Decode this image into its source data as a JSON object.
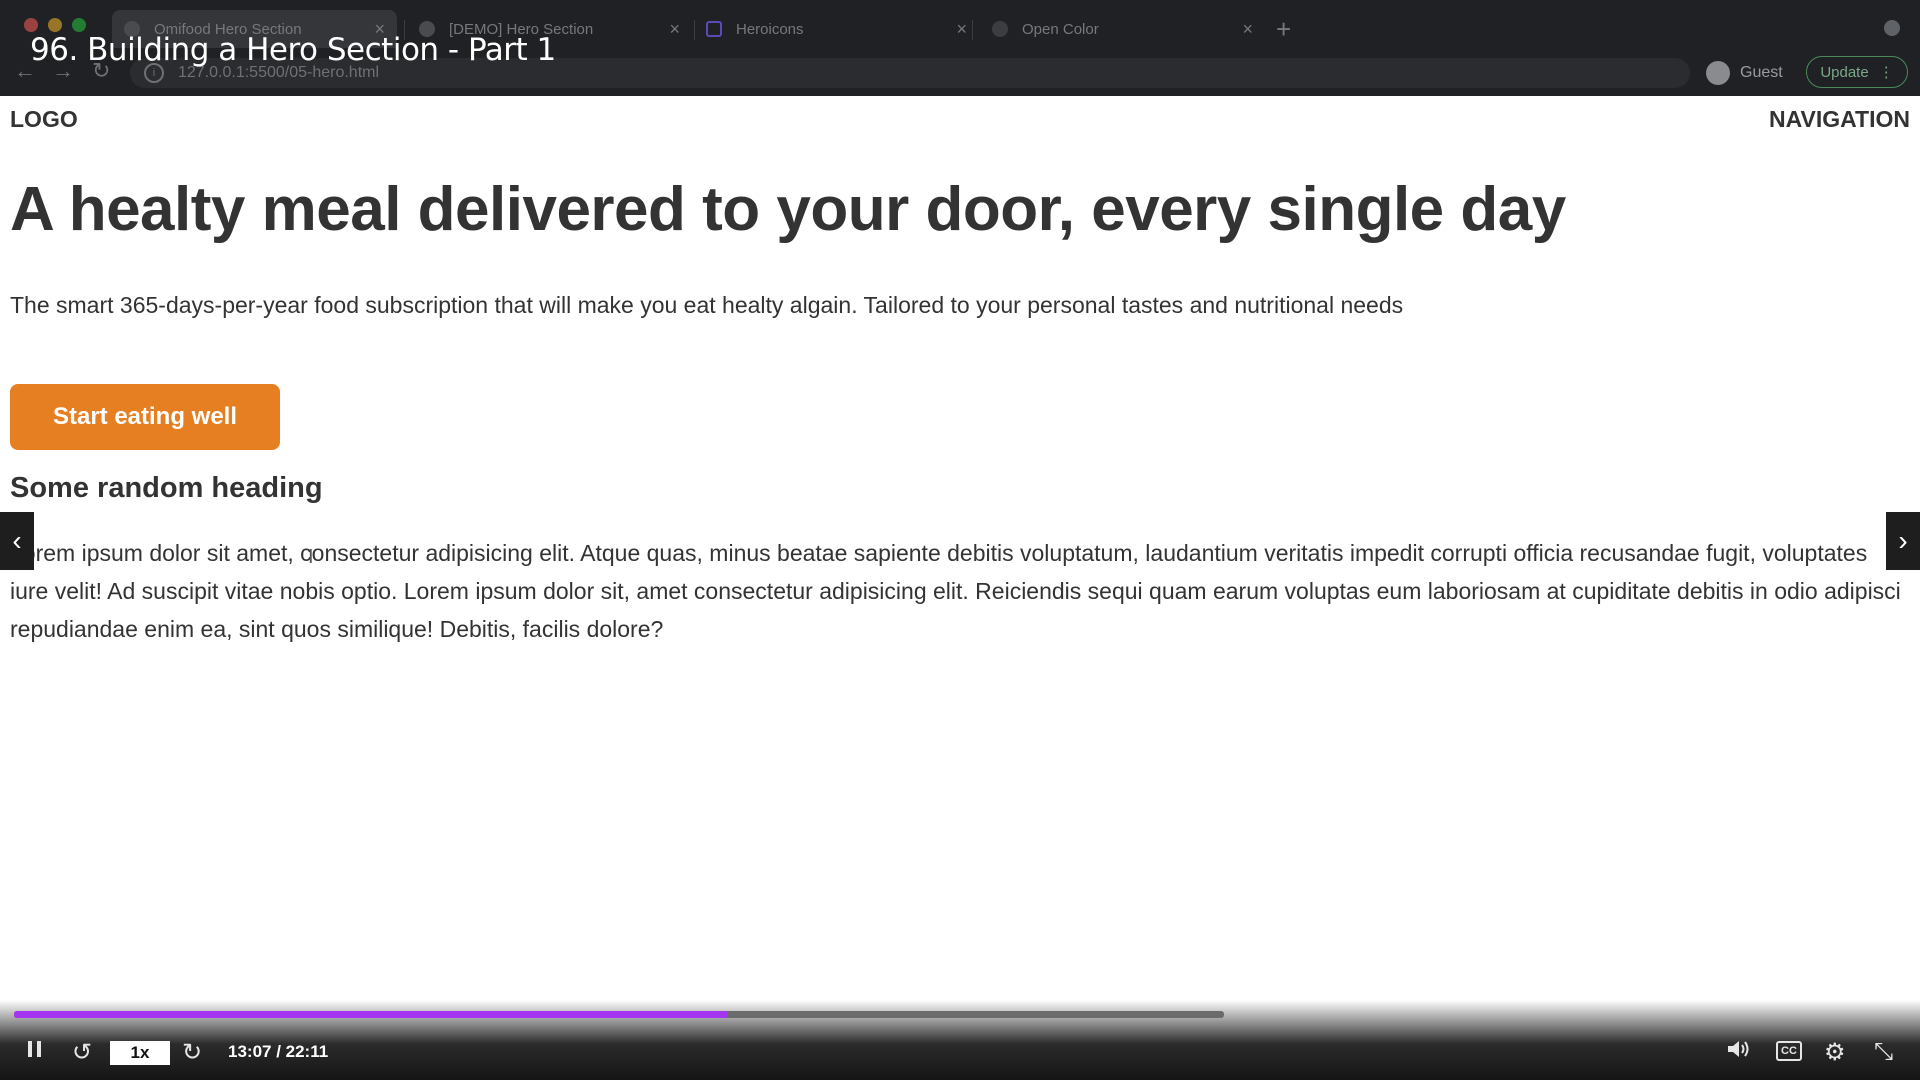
{
  "browser": {
    "tabs": [
      {
        "title": "Omifood Hero Section",
        "active": true
      },
      {
        "title": "[DEMO] Hero Section",
        "active": false
      },
      {
        "title": "Heroicons",
        "active": false
      },
      {
        "title": "Open Color",
        "active": false
      }
    ],
    "url": "127.0.0.1:5500/05-hero.html",
    "profile_label": "Guest",
    "update_label": "Update"
  },
  "video": {
    "title": "96. Building a Hero Section - Part 1",
    "speed": "1x",
    "time": "13:07 / 22:11",
    "progress": 0.59,
    "buffered": 0.63
  },
  "page": {
    "logo": "LOGO",
    "navigation": "NAVIGATION",
    "hero_heading": "A healty meal delivered to your door, every single day",
    "hero_description": "The smart 365-days-per-year food subscription that will make you eat healty algain. Tailored to your personal tastes and nutritional needs",
    "cta_label": "Start eating well",
    "section_heading": "Some random heading",
    "paragraph": "Lorem ipsum dolor sit amet, consectetur adipisicing elit. Atque quas, minus beatae sapiente debitis voluptatum, laudantium veritatis impedit corrupti officia recusandae fugit, voluptates iure velit! Ad suscipit vitae nobis optio. Lorem ipsum dolor sit, amet consectetur adipisicing elit. Reiciendis sequi quam earum voluptas eum laboriosam at cupiditate debitis in odio adipisci repudiandae enim ea, sint quos similique! Debitis, facilis dolore?"
  },
  "icons": {
    "back": "arrow-left-icon",
    "forward": "arrow-right-icon",
    "reload": "reload-icon",
    "info": "info-icon",
    "prev": "chevron-left-icon",
    "next": "chevron-right-icon",
    "pause": "pause-icon",
    "rewind": "rewind-icon",
    "forward_skip": "forward-icon",
    "volume": "volume-icon",
    "captions": "captions-icon",
    "settings": "gear-icon",
    "exit_fullscreen": "exit-fullscreen-icon"
  },
  "colors": {
    "accent": "#e67e22",
    "text": "#333333",
    "progress": "#a435f0",
    "chrome": "#202124"
  }
}
